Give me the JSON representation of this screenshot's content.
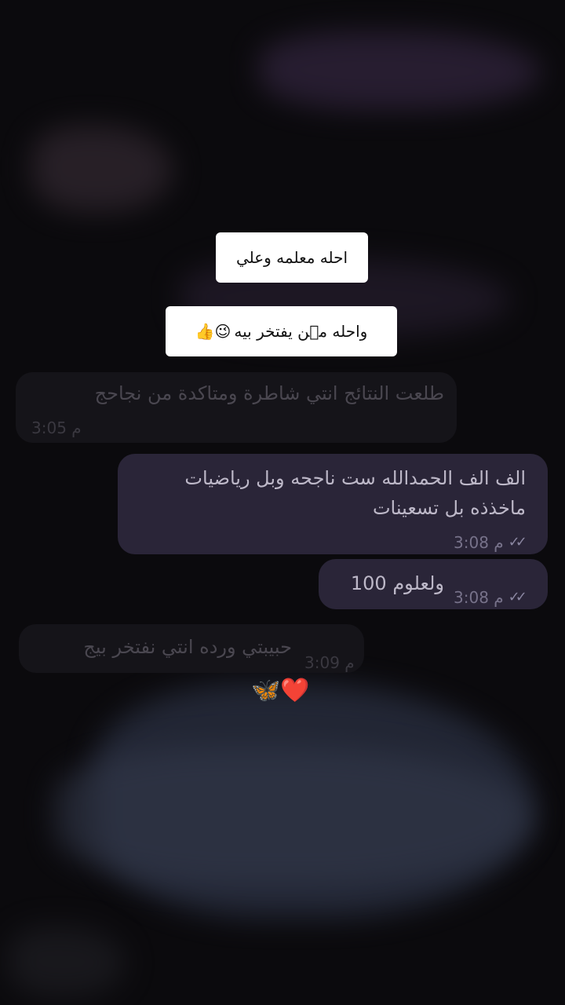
{
  "captions": {
    "line1": "احله معلمه وعلي",
    "line2": "واحله مۨن يفتخر بيه",
    "line2_emoji": "😉👍"
  },
  "messages": [
    {
      "direction": "incoming",
      "text": "طلعت النتائج انتي شاطرة ومتاكدة من نجاحج",
      "time": "3:05 م"
    },
    {
      "direction": "outgoing",
      "text_line1": "الف الف الحمدالله ست ناجحه وبل رياضيات",
      "text_line2": "ماخذذه بل تسعينات",
      "time": "3:08 م",
      "status_icon": "double-check-icon"
    },
    {
      "direction": "outgoing",
      "text": "ولعلوم 100",
      "time": "3:08 م",
      "status_icon": "double-check-icon"
    },
    {
      "direction": "incoming",
      "text": "حبيبتي ورده انتي نفتخر بيج",
      "time": "3:09 م"
    }
  ],
  "decor": {
    "heart": "❤️",
    "butterfly": "🦋"
  },
  "colors": {
    "background": "#0b0a0d",
    "outgoing_bubble": "#2a2538",
    "incoming_bubble": "#151419",
    "caption_bg": "#ffffff"
  }
}
